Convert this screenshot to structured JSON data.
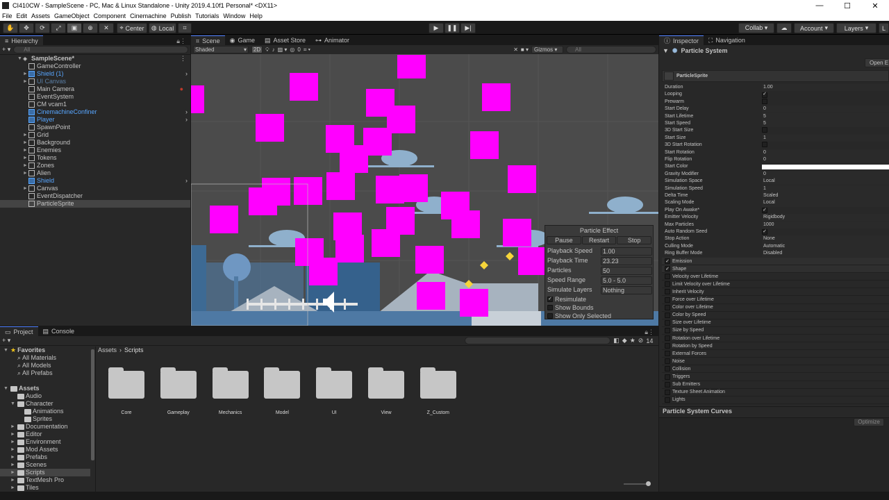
{
  "window": {
    "title": "CI410CW - SampleScene - PC, Mac & Linux Standalone - Unity 2019.4.10f1 Personal* <DX11>"
  },
  "menu": [
    "File",
    "Edit",
    "Assets",
    "GameObject",
    "Component",
    "Cinemachine",
    "Publish",
    "Tutorials",
    "Window",
    "Help"
  ],
  "toolbar": {
    "center": "Center",
    "local": "Local",
    "collab": "Collab ▾",
    "account": "Account",
    "layers": "Layers"
  },
  "hierarchy": {
    "tab": "Hierarchy",
    "search_placeholder": "All",
    "scene": "SampleScene*",
    "items": [
      {
        "label": "GameController",
        "kind": "normal"
      },
      {
        "label": "Shield (1)",
        "kind": "prefab"
      },
      {
        "label": "UI Canvas",
        "kind": "disabled"
      },
      {
        "label": "Main Camera",
        "kind": "normal"
      },
      {
        "label": "EventSystem",
        "kind": "normal"
      },
      {
        "label": "CM vcam1",
        "kind": "normal"
      },
      {
        "label": "CinemachineConfiner",
        "kind": "prefab"
      },
      {
        "label": "Player",
        "kind": "prefab"
      },
      {
        "label": "SpawnPoint",
        "kind": "normal"
      },
      {
        "label": "Grid",
        "kind": "normal"
      },
      {
        "label": "Background",
        "kind": "normal"
      },
      {
        "label": "Enemies",
        "kind": "normal"
      },
      {
        "label": "Tokens",
        "kind": "normal"
      },
      {
        "label": "Zones",
        "kind": "normal"
      },
      {
        "label": "Alien",
        "kind": "normal"
      },
      {
        "label": "Shield",
        "kind": "prefab"
      },
      {
        "label": "Canvas",
        "kind": "normal"
      },
      {
        "label": "EventDispatcher",
        "kind": "normal"
      },
      {
        "label": "ParticleSprite",
        "kind": "selected"
      }
    ]
  },
  "scene_tabs": [
    "Scene",
    "Game",
    "Asset Store",
    "Animator"
  ],
  "scene_toolbar": {
    "shading": "Shaded",
    "mode2d": "2D",
    "hidden_count": "0",
    "gizmos": "Gizmos",
    "search_placeholder": "All"
  },
  "particle_effect": {
    "title": "Particle Effect",
    "buttons": [
      "Pause",
      "Restart",
      "Stop"
    ],
    "rows": [
      {
        "label": "Playback Speed",
        "value": "1.00"
      },
      {
        "label": "Playback Time",
        "value": "23.23"
      },
      {
        "label": "Particles",
        "value": "50"
      },
      {
        "label": "Speed Range",
        "value": "5.0 - 5.0"
      },
      {
        "label": "Simulate Layers",
        "value": "Nothing"
      }
    ],
    "checks": [
      {
        "label": "Resimulate",
        "checked": true
      },
      {
        "label": "Show Bounds",
        "checked": false
      },
      {
        "label": "Show Only Selected",
        "checked": false
      }
    ]
  },
  "inspector": {
    "tabs": [
      "Inspector",
      "Navigation"
    ],
    "component": "Particle System",
    "open_editor": "Open E",
    "system_name": "ParticleSprite",
    "props": [
      {
        "label": "Duration",
        "value": "1.00"
      },
      {
        "label": "Looping",
        "value": "✓"
      },
      {
        "label": "Prewarm",
        "value": ""
      },
      {
        "label": "Start Delay",
        "value": "0"
      },
      {
        "label": "Start Lifetime",
        "value": "5"
      },
      {
        "label": "Start Speed",
        "value": "5"
      },
      {
        "label": "3D Start Size",
        "value": ""
      },
      {
        "label": "Start Size",
        "value": "1"
      },
      {
        "label": "3D Start Rotation",
        "value": ""
      },
      {
        "label": "Start Rotation",
        "value": "0"
      },
      {
        "label": "Flip Rotation",
        "value": "0"
      },
      {
        "label": "Start Color",
        "value": ""
      },
      {
        "label": "Gravity Modifier",
        "value": "0"
      },
      {
        "label": "Simulation Space",
        "value": "Local"
      },
      {
        "label": "Simulation Speed",
        "value": "1"
      },
      {
        "label": "Delta Time",
        "value": "Scaled"
      },
      {
        "label": "Scaling Mode",
        "value": "Local"
      },
      {
        "label": "Play On Awake*",
        "value": "✓"
      },
      {
        "label": "Emitter Velocity",
        "value": "Rigidbody"
      },
      {
        "label": "Max Particles",
        "value": "1000"
      },
      {
        "label": "Auto Random Seed",
        "value": "✓"
      },
      {
        "label": "Stop Action",
        "value": "None"
      },
      {
        "label": "Culling Mode",
        "value": "Automatic"
      },
      {
        "label": "Ring Buffer Mode",
        "value": "Disabled"
      }
    ],
    "modules": [
      {
        "label": "Emission",
        "checked": true
      },
      {
        "label": "Shape",
        "checked": true
      },
      {
        "label": "Velocity over Lifetime",
        "checked": false
      },
      {
        "label": "Limit Velocity over Lifetime",
        "checked": false
      },
      {
        "label": "Inherit Velocity",
        "checked": false
      },
      {
        "label": "Force over Lifetime",
        "checked": false
      },
      {
        "label": "Color over Lifetime",
        "checked": false
      },
      {
        "label": "Color by Speed",
        "checked": false
      },
      {
        "label": "Size over Lifetime",
        "checked": false
      },
      {
        "label": "Size by Speed",
        "checked": false
      },
      {
        "label": "Rotation over Lifetime",
        "checked": false
      },
      {
        "label": "Rotation by Speed",
        "checked": false
      },
      {
        "label": "External Forces",
        "checked": false
      },
      {
        "label": "Noise",
        "checked": false
      },
      {
        "label": "Collision",
        "checked": false
      },
      {
        "label": "Triggers",
        "checked": false
      },
      {
        "label": "Sub Emitters",
        "checked": false
      },
      {
        "label": "Texture Sheet Animation",
        "checked": false
      },
      {
        "label": "Lights",
        "checked": false
      }
    ],
    "curves_title": "Particle System Curves",
    "optimize": "Optimize"
  },
  "project": {
    "tabs": [
      "Project",
      "Console"
    ],
    "layer_count": "14",
    "breadcrumb": [
      "Assets",
      "Scripts"
    ],
    "favorites": {
      "label": "Favorites",
      "items": [
        "All Materials",
        "All Models",
        "All Prefabs"
      ]
    },
    "assets": {
      "label": "Assets",
      "items": [
        {
          "label": "Audio",
          "indent": 1
        },
        {
          "label": "Character",
          "indent": 1
        },
        {
          "label": "Animations",
          "indent": 2
        },
        {
          "label": "Sprites",
          "indent": 2
        },
        {
          "label": "Documentation",
          "indent": 1
        },
        {
          "label": "Editor",
          "indent": 1
        },
        {
          "label": "Environment",
          "indent": 1
        },
        {
          "label": "Mod Assets",
          "indent": 1
        },
        {
          "label": "Prefabs",
          "indent": 1
        },
        {
          "label": "Scenes",
          "indent": 1
        },
        {
          "label": "Scripts",
          "indent": 1
        },
        {
          "label": "TextMesh Pro",
          "indent": 1
        },
        {
          "label": "Tiles",
          "indent": 1
        }
      ]
    },
    "folders": [
      "Core",
      "Gameplay",
      "Mechanics",
      "Model",
      "UI",
      "View",
      "Z_Custom"
    ]
  },
  "colors": {
    "particle": "#ff00ff",
    "accent": "#4c7eff",
    "selected_row": "#2c5d87"
  }
}
